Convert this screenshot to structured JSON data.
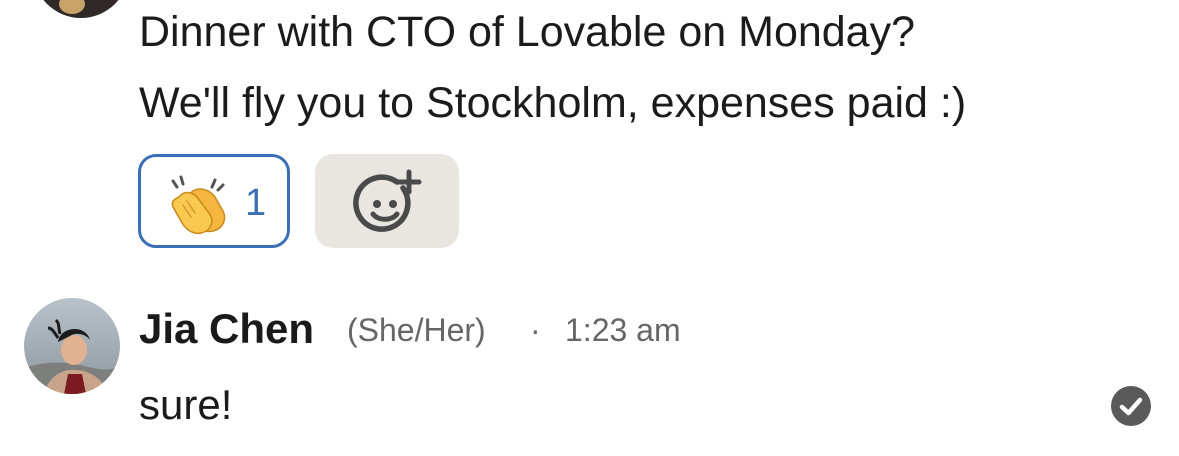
{
  "previous_message": {
    "lines": [
      "Dinner with CTO of Lovable on Monday?",
      "We'll fly you to Stockholm, expenses paid :)"
    ],
    "reactions": [
      {
        "emoji": "clapping-hands",
        "count": "1",
        "selected": true,
        "accent": "#3a6fb6"
      }
    ],
    "add_reaction_icon": "add-reaction-smiley-icon"
  },
  "reply": {
    "author": "Jia Chen",
    "pronouns": "(She/Her)",
    "separator": "·",
    "time": "1:23 am",
    "text": "sure!",
    "status_icon": "read-receipt-check-icon"
  },
  "colors": {
    "accent_blue": "#3a6fb6",
    "add_reaction_bg": "#e9e6e2",
    "meta_gray": "#666666",
    "receipt_gray": "#5a5a5a"
  }
}
